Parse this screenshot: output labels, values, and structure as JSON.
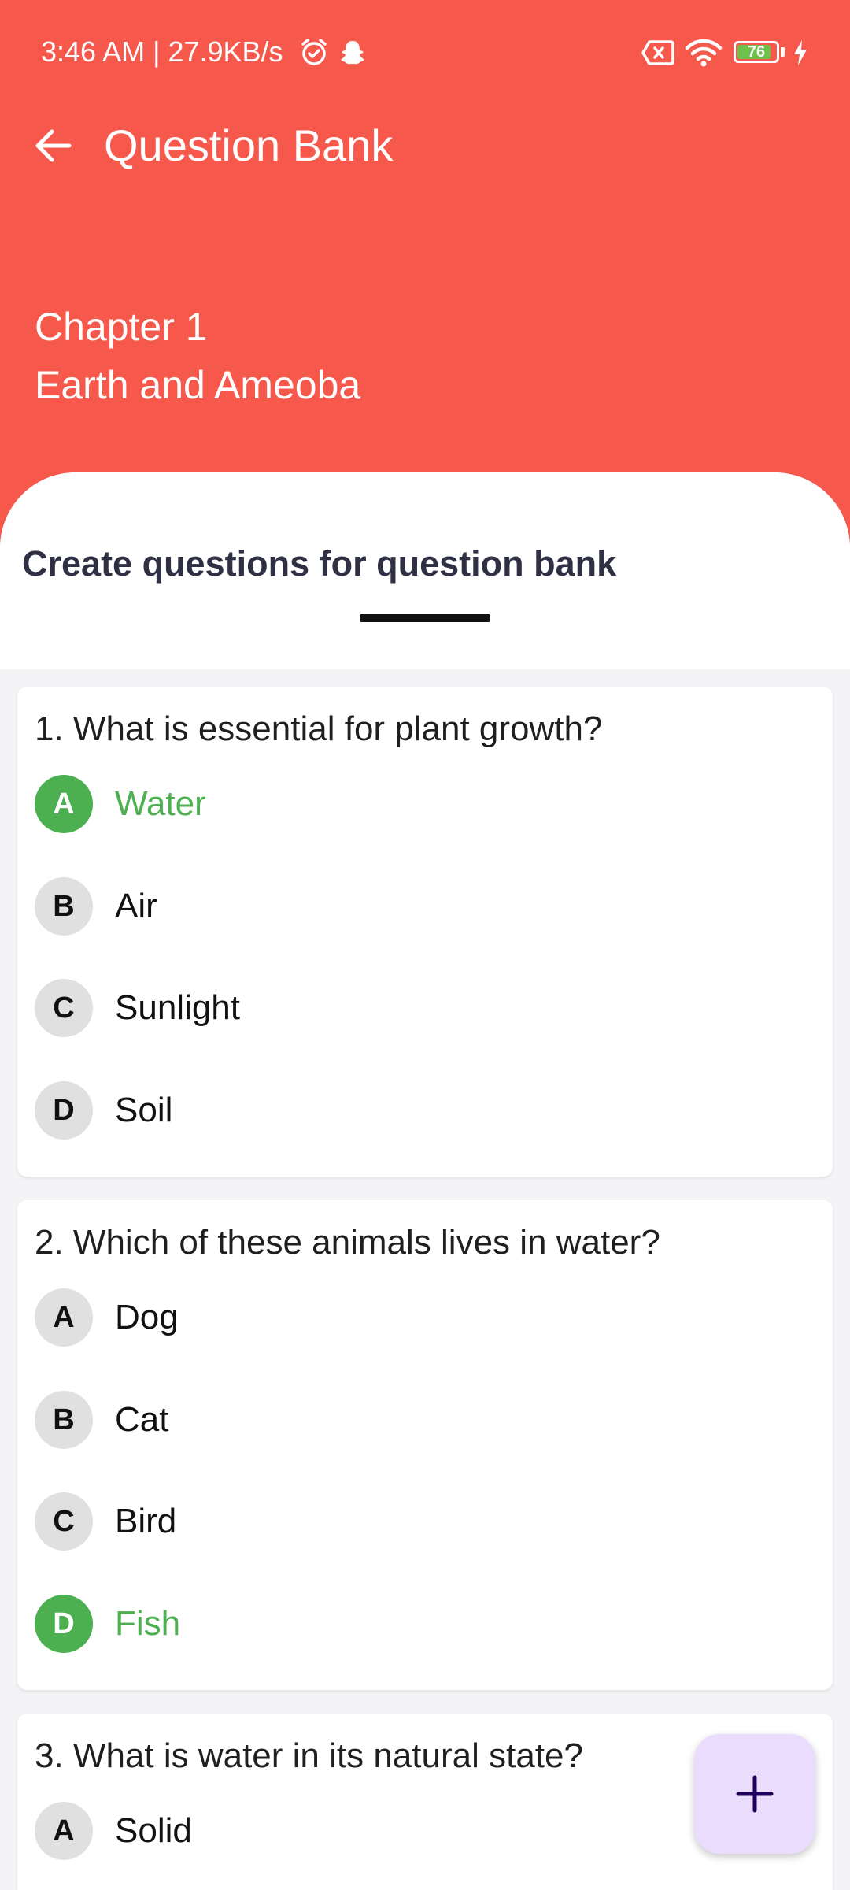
{
  "status_bar": {
    "left_text": "3:46 AM | 27.9KB/s",
    "battery_level": "76",
    "icons": [
      "alarm-icon",
      "snapchat-icon",
      "no-sim-icon",
      "wifi-icon",
      "battery-icon",
      "charging-icon"
    ]
  },
  "toolbar": {
    "title": "Question Bank",
    "back_icon": "arrow-left-icon"
  },
  "header": {
    "chapter_number": "Chapter 1",
    "chapter_title": "Earth and Ameoba"
  },
  "sheet": {
    "heading": "Create questions for question bank"
  },
  "questions": [
    {
      "text": "1. What is essential for plant growth?",
      "options": [
        {
          "letter": "A",
          "text": "Water",
          "correct": true
        },
        {
          "letter": "B",
          "text": "Air",
          "correct": false
        },
        {
          "letter": "C",
          "text": "Sunlight",
          "correct": false
        },
        {
          "letter": "D",
          "text": "Soil",
          "correct": false
        }
      ]
    },
    {
      "text": "2. Which of these animals lives in water?",
      "options": [
        {
          "letter": "A",
          "text": "Dog",
          "correct": false
        },
        {
          "letter": "B",
          "text": "Cat",
          "correct": false
        },
        {
          "letter": "C",
          "text": "Bird",
          "correct": false
        },
        {
          "letter": "D",
          "text": "Fish",
          "correct": true
        }
      ]
    },
    {
      "text": "3. What is water in its natural state?",
      "options": [
        {
          "letter": "A",
          "text": "Solid",
          "correct": false
        }
      ]
    }
  ],
  "fab": {
    "icon": "plus-icon"
  },
  "colors": {
    "header": "#f6584c",
    "correct": "#4caf50",
    "fab": "#eadcfc"
  }
}
